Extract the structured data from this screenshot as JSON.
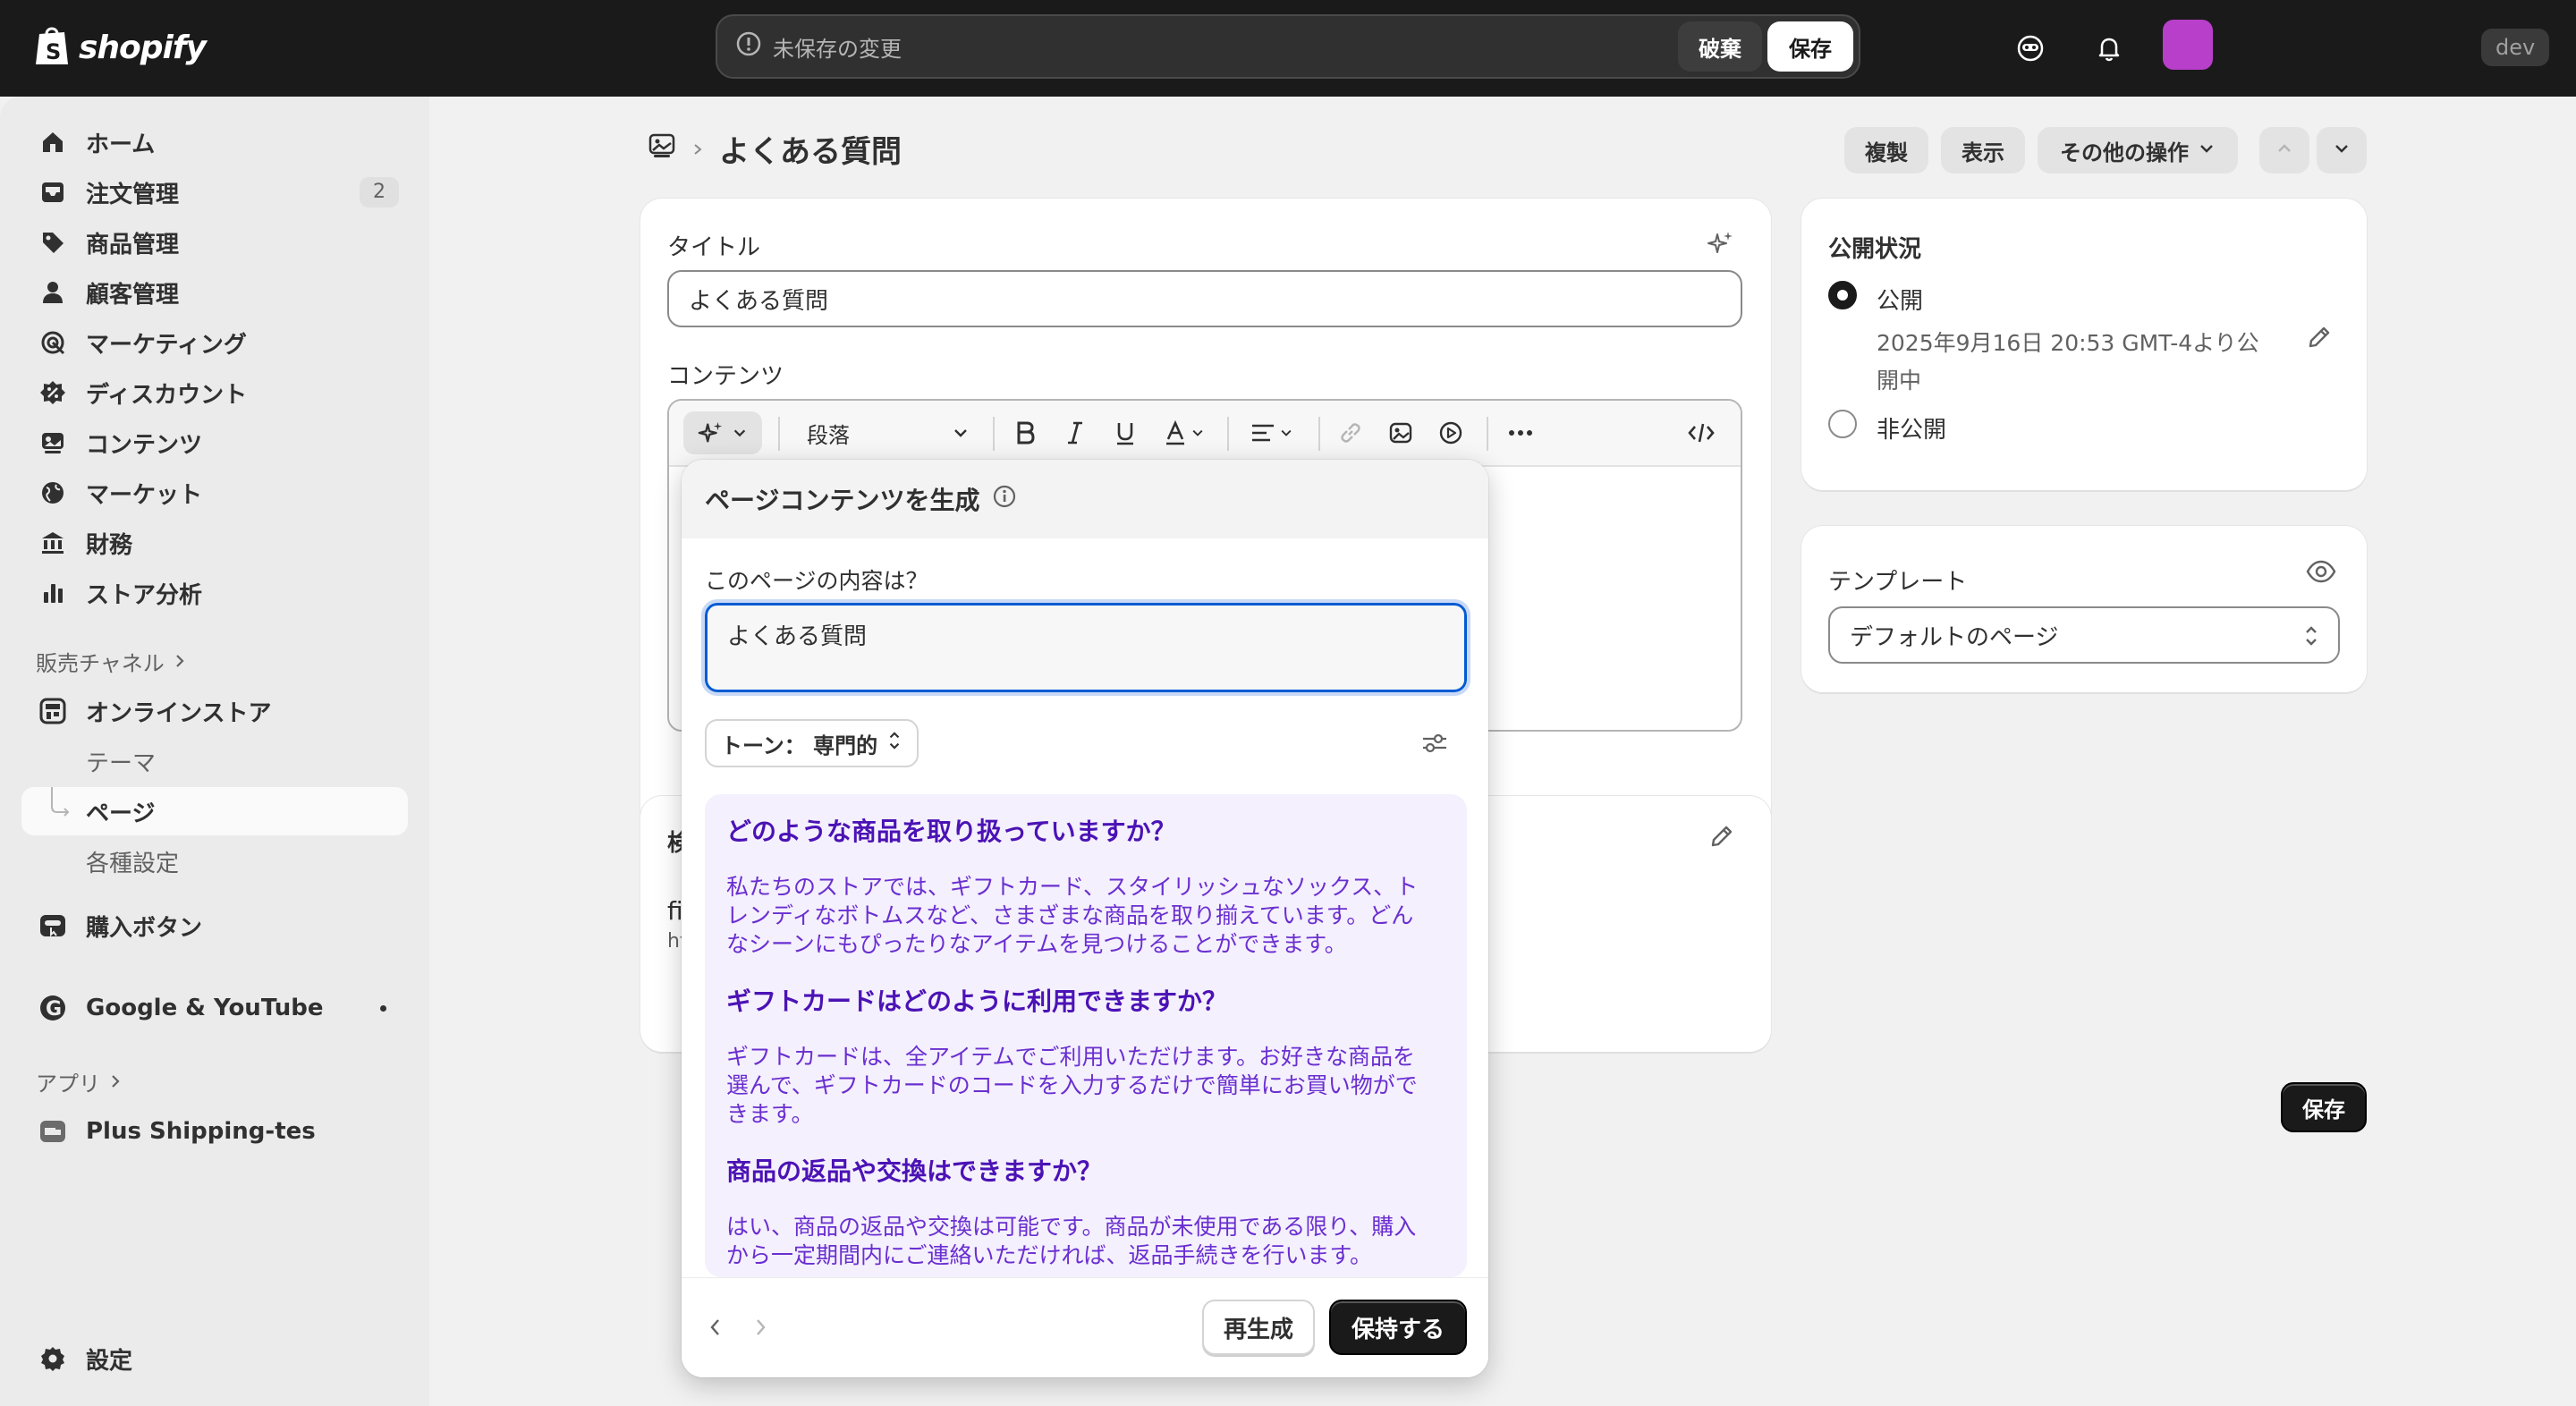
{
  "topbar": {
    "brand": "shopify",
    "unsaved_message": "未保存の変更",
    "discard_label": "破棄",
    "save_label": "保存",
    "dev_label": "dev"
  },
  "sidebar": {
    "items": [
      {
        "label": "ホーム",
        "icon": "home-icon"
      },
      {
        "label": "注文管理",
        "icon": "inbox-icon",
        "badge": "2"
      },
      {
        "label": "商品管理",
        "icon": "tag-icon"
      },
      {
        "label": "顧客管理",
        "icon": "person-icon"
      },
      {
        "label": "マーケティング",
        "icon": "target-icon"
      },
      {
        "label": "ディスカウント",
        "icon": "discount-icon"
      },
      {
        "label": "コンテンツ",
        "icon": "content-icon"
      },
      {
        "label": "マーケット",
        "icon": "globe-icon"
      },
      {
        "label": "財務",
        "icon": "bank-icon"
      },
      {
        "label": "ストア分析",
        "icon": "chart-icon"
      }
    ],
    "sales_channels_title": "販売チャネル",
    "online_store": "オンラインストア",
    "online_store_sub": [
      "テーマ",
      "ページ",
      "各種設定"
    ],
    "buy_button": "購入ボタン",
    "google": "Google & YouTube",
    "apps_title": "アプリ",
    "plus_shipping": "Plus Shipping-tes",
    "settings": "設定"
  },
  "header": {
    "title": "よくある質問",
    "duplicate": "複製",
    "view": "表示",
    "more_actions": "その他の操作"
  },
  "main_card": {
    "title_label": "タイトル",
    "title_value": "よくある質問",
    "content_label": "コンテンツ",
    "paragraph_select": "段落"
  },
  "seo_card": {
    "heading_fragment": "検",
    "line1_fragment": "fi",
    "line2_fragment": "ht"
  },
  "popover": {
    "title": "ページコンテンツを生成",
    "question_label": "このページの内容は？",
    "question_value": "よくある質問",
    "tone_label": "トーン： 専門的",
    "generated": [
      {
        "q": "どのような商品を取り扱っていますか？",
        "a": [
          "私たちのストアでは、ギフトカード、スタイリッシュなソックス、ト",
          "レンディなボトムスなど、さまざまな商品を取り揃えています。どん",
          "なシーンにもぴったりなアイテムを見つけることができます。"
        ]
      },
      {
        "q": "ギフトカードはどのように利用できますか？",
        "a": [
          "ギフトカードは、全アイテムでご利用いただけます。お好きな商品を",
          "選んで、ギフトカードのコードを入力するだけで簡単にお買い物がで",
          "きます。"
        ]
      },
      {
        "q": "商品の返品や交換はできますか？",
        "a": [
          "はい、商品の返品や交換は可能です。商品が未使用である限り、購入",
          "から一定期間内にご連絡いただければ、返品手続きを行います。"
        ]
      }
    ],
    "regenerate_label": "再生成",
    "keep_label": "保持する"
  },
  "visibility_card": {
    "title": "公開状況",
    "published_label": "公開",
    "published_date_line1": "2025年9月16日 20:53 GMT-4より公",
    "published_date_line2": "開中",
    "unpublished_label": "非公開"
  },
  "template_card": {
    "title": "テンプレート",
    "selected": "デフォルトのページ"
  },
  "bottom_save": "保存",
  "colors": {
    "topbar": "#1a1a1a",
    "accent_purple": "#4b12b5",
    "focus_blue": "#005bd3",
    "avatar": "#b83fc9"
  }
}
